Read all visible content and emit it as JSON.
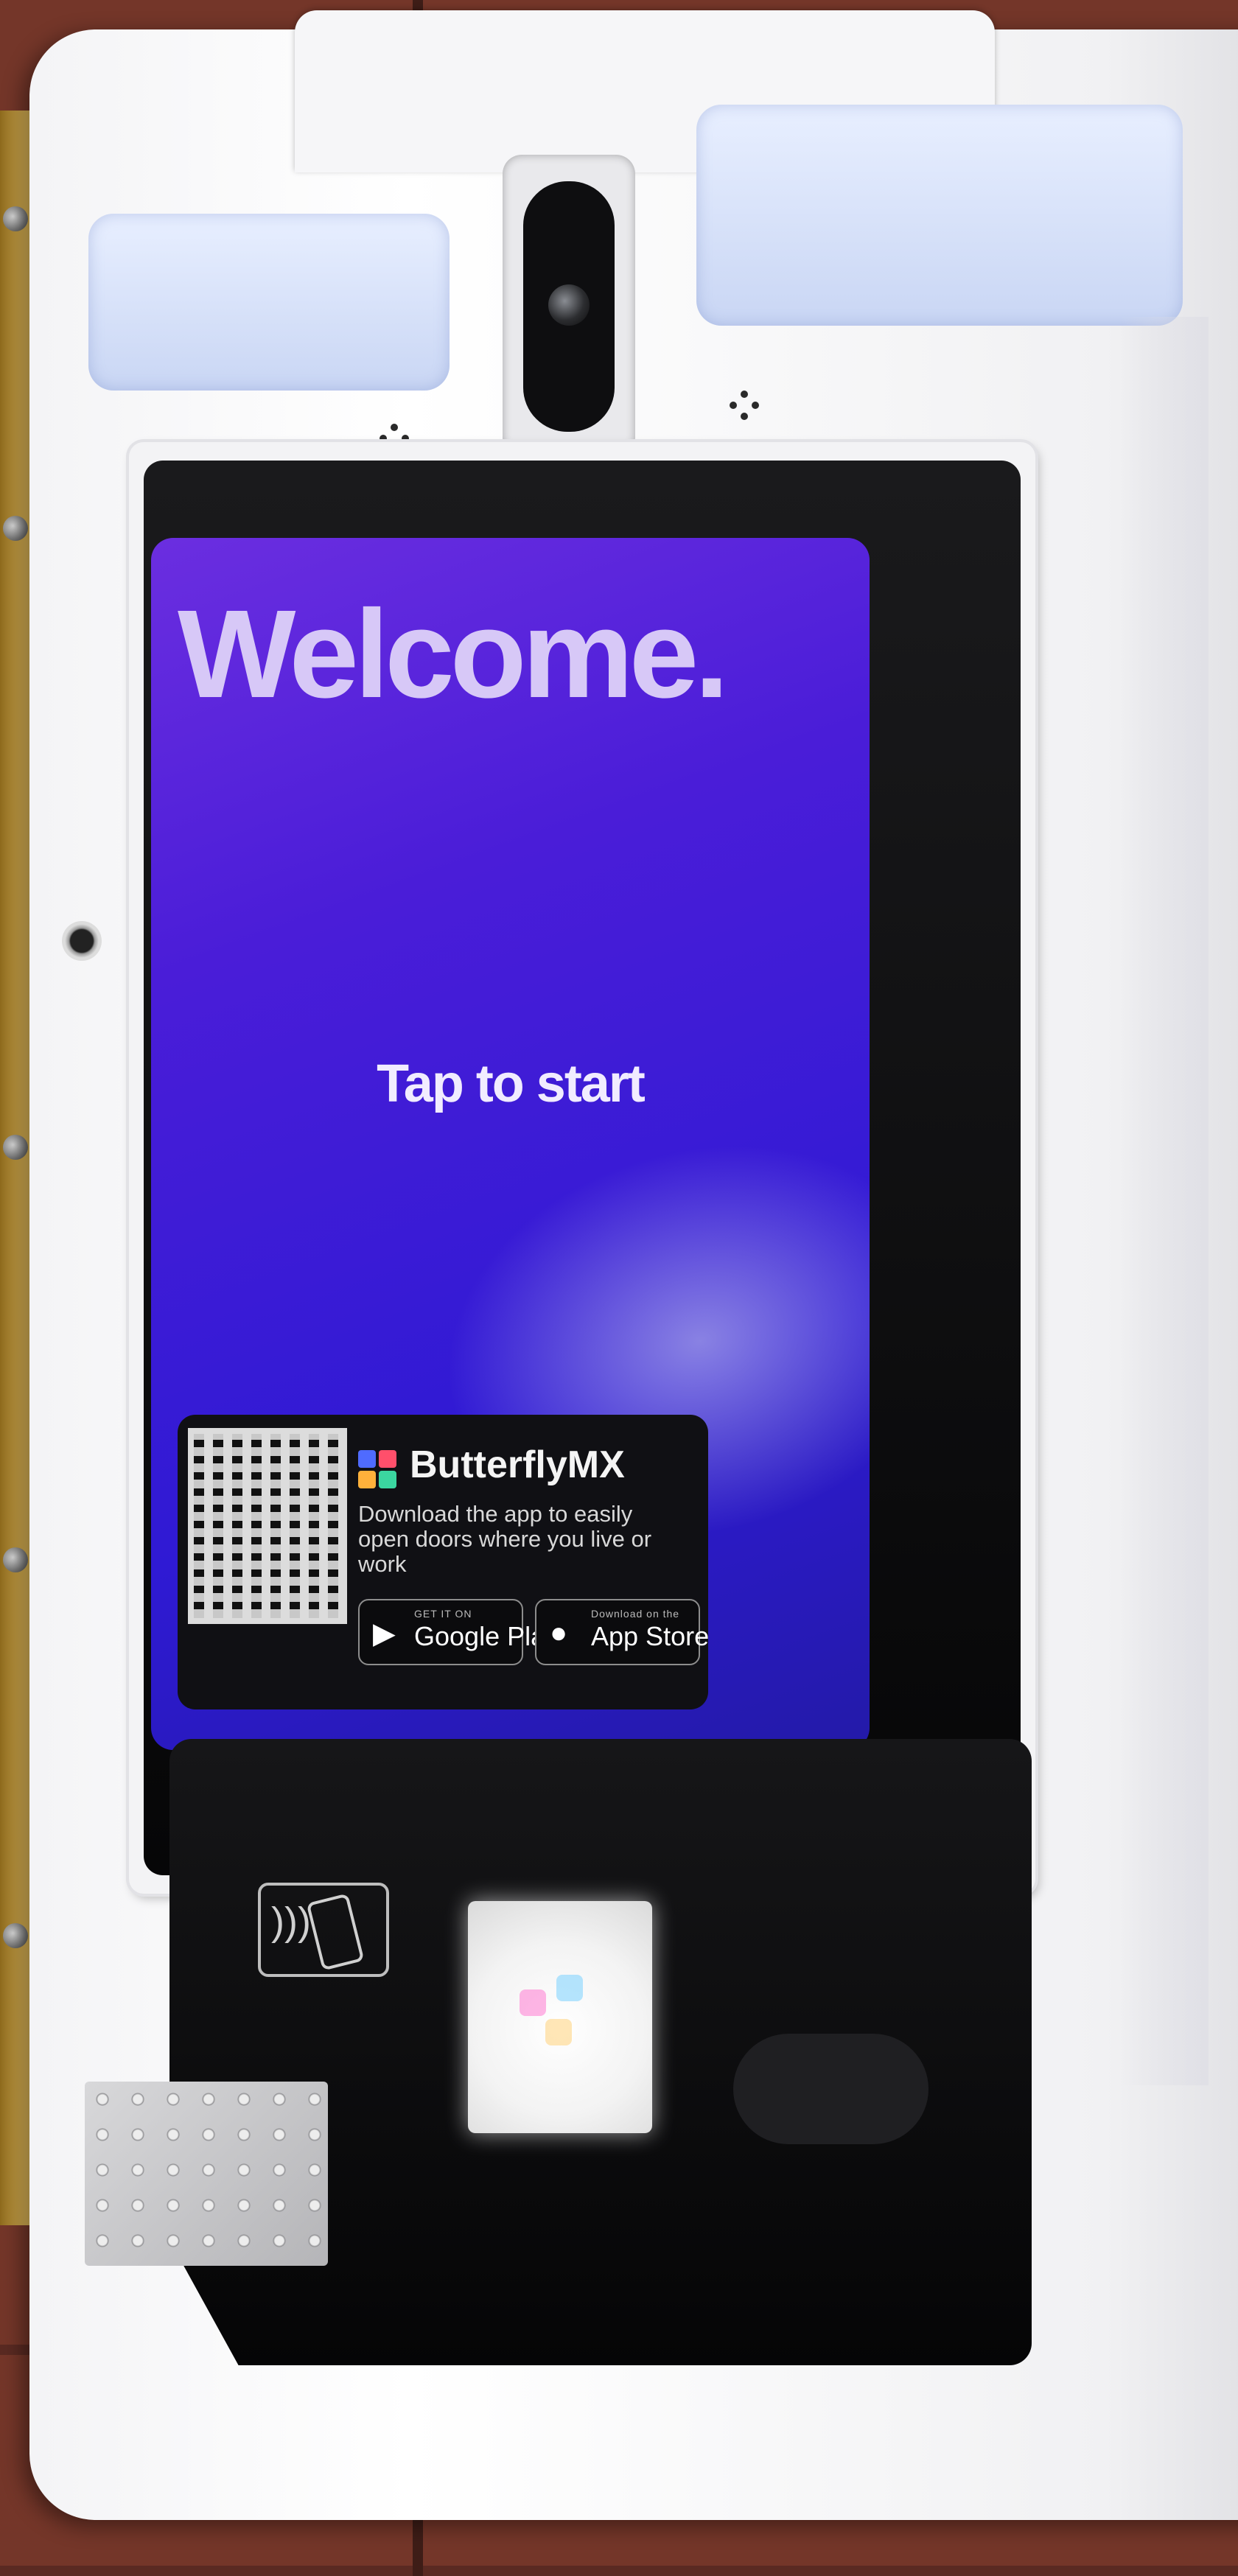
{
  "screen": {
    "heading": "Welcome.",
    "prompt": "Tap to start"
  },
  "promo": {
    "brand": "ButterflyMX",
    "tagline": "Download the app to easily open doors where you live or work",
    "google_play": {
      "small": "GET IT ON",
      "label": "Google Play"
    },
    "app_store": {
      "small": "Download on the",
      "label": "App Store"
    }
  },
  "colors": {
    "screen_top": "#6b2ee0",
    "screen_bottom": "#231aa8",
    "housing": "#f4f4f6"
  },
  "icons": [
    "camera-icon",
    "qr-code-icon",
    "butterflymx-logo-icon",
    "google-play-icon",
    "apple-icon",
    "nfc-tap-icon",
    "braille-plate"
  ]
}
